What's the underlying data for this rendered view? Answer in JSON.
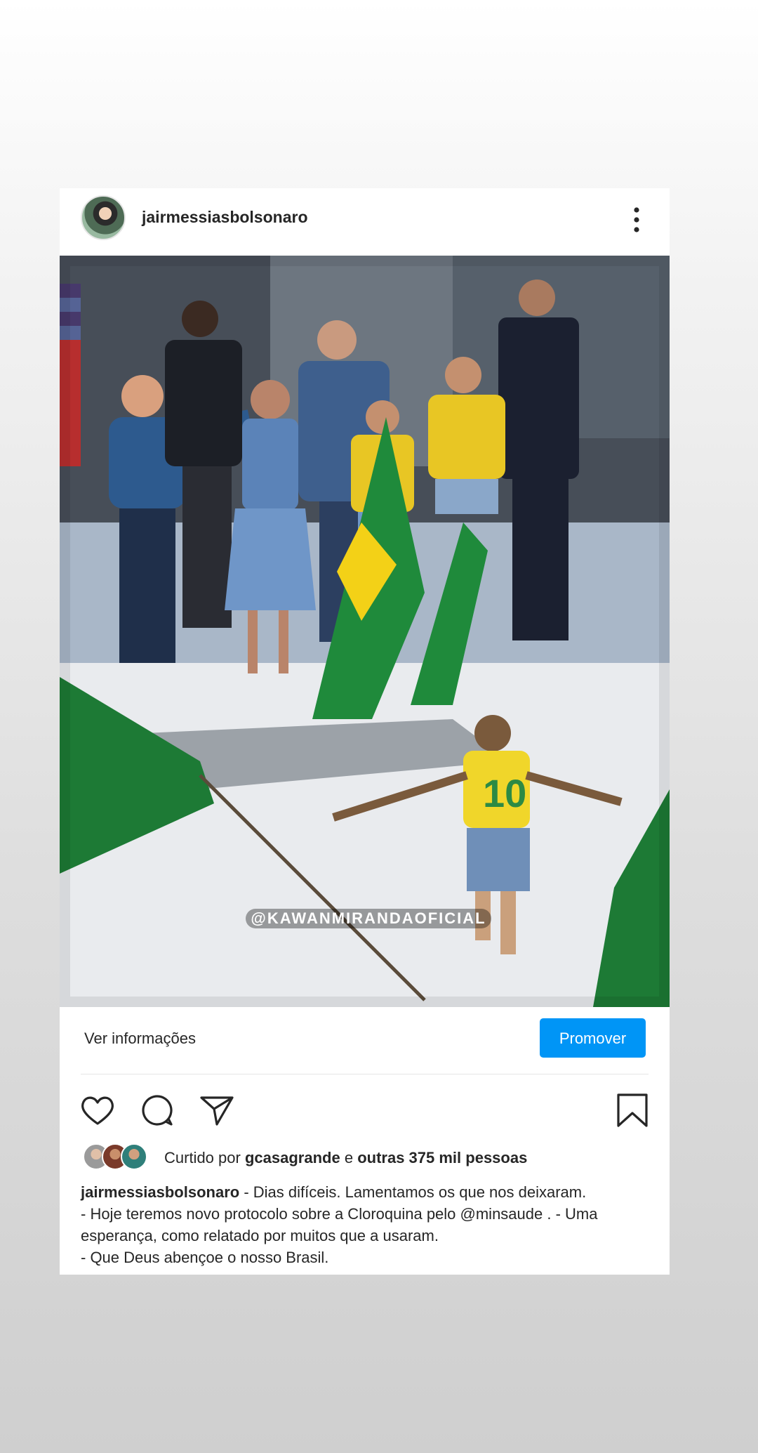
{
  "post": {
    "username": "jairmessiasbolsonaro",
    "watermark": "@KAWANMIRANDAOFICIAL",
    "more_icon": "vertical-ellipsis-icon"
  },
  "promo": {
    "info_label": "Ver informações",
    "promote_label": "Promover",
    "accent_color": "#0095f6"
  },
  "actions": {
    "like_icon": "heart-icon",
    "comment_icon": "comment-bubble-icon",
    "share_icon": "paper-plane-icon",
    "save_icon": "bookmark-icon"
  },
  "likes": {
    "prefix": "Curtido por",
    "user": "gcasagrande",
    "middle": "e",
    "others": "outras 375 mil pessoas"
  },
  "caption": {
    "user": "jairmessiasbolsonaro",
    "line1": " - Dias difíceis. Lamentamos os que nos deixaram.",
    "line2": "- Hoje teremos novo protocolo sobre a Cloroquina pelo @minsaude . - Uma",
    "line3": "esperança, como relatado por muitos que a usaram.",
    "line4": "- Que Deus abençoe o nosso Brasil."
  }
}
